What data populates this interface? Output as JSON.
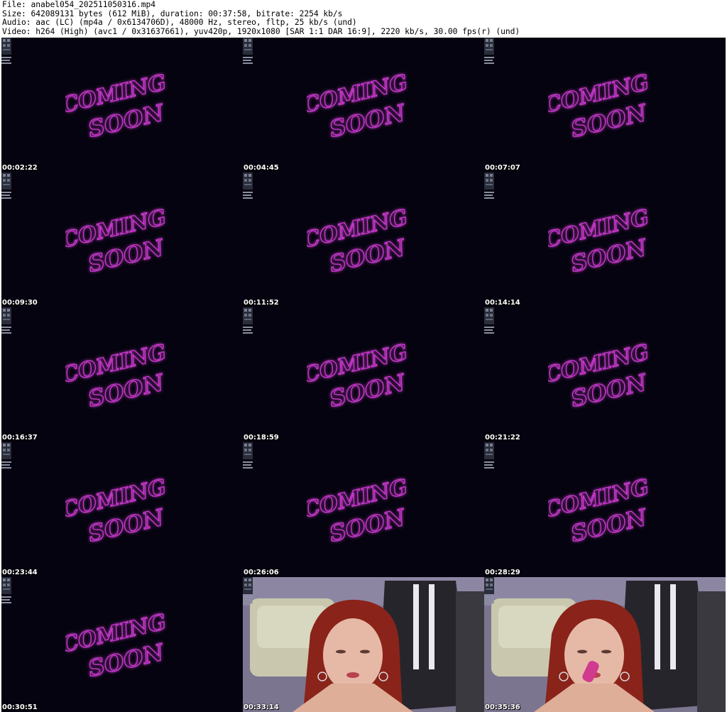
{
  "header": {
    "line1": "File: anabel054_202511050316.mp4",
    "line2": "Size: 642089131 bytes (612 MiB), duration: 00:37:58, bitrate: 2254 kb/s",
    "line3": "Audio: aac (LC) (mp4a / 0x6134706D), 48000 Hz, stereo, fltp, 25 kb/s (und)",
    "line4": "Video: h264 (High) (avc1 / 0x31637661), yuv420p, 1920x1080 [SAR 1:1 DAR 16:9], 2220 kb/s, 30.00 fps(r) (und)"
  },
  "sign": {
    "word1": "COMING",
    "word2": "SOON",
    "color": "#d23cd6"
  },
  "thumbnails": [
    {
      "timestamp": "00:02:22",
      "scene": "coming-soon"
    },
    {
      "timestamp": "00:04:45",
      "scene": "coming-soon"
    },
    {
      "timestamp": "00:07:07",
      "scene": "coming-soon"
    },
    {
      "timestamp": "00:09:30",
      "scene": "coming-soon"
    },
    {
      "timestamp": "00:11:52",
      "scene": "coming-soon"
    },
    {
      "timestamp": "00:14:14",
      "scene": "coming-soon"
    },
    {
      "timestamp": "00:16:37",
      "scene": "coming-soon"
    },
    {
      "timestamp": "00:18:59",
      "scene": "coming-soon"
    },
    {
      "timestamp": "00:21:22",
      "scene": "coming-soon"
    },
    {
      "timestamp": "00:23:44",
      "scene": "coming-soon"
    },
    {
      "timestamp": "00:26:06",
      "scene": "coming-soon"
    },
    {
      "timestamp": "00:28:29",
      "scene": "coming-soon"
    },
    {
      "timestamp": "00:30:51",
      "scene": "coming-soon"
    },
    {
      "timestamp": "00:33:14",
      "scene": "camera"
    },
    {
      "timestamp": "00:35:36",
      "scene": "camera"
    }
  ]
}
